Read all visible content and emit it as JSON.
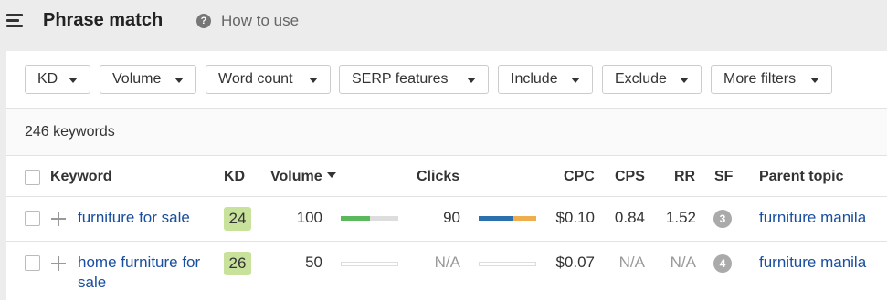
{
  "header": {
    "title": "Phrase match",
    "help_icon_glyph": "?",
    "how_to_use": "How to use"
  },
  "filters": [
    "KD",
    "Volume",
    "Word count",
    "SERP features",
    "Include",
    "Exclude",
    "More filters"
  ],
  "keyword_count": "246 keywords",
  "columns": {
    "keyword": "Keyword",
    "kd": "KD",
    "volume": "Volume",
    "clicks": "Clicks",
    "cpc": "CPC",
    "cps": "CPS",
    "rr": "RR",
    "sf": "SF",
    "parent_topic": "Parent topic"
  },
  "rows": [
    {
      "keyword": "furniture for sale",
      "kd": "24",
      "volume": "100",
      "volume_level": 0.5,
      "clicks": "90",
      "clicks_split": [
        0.6,
        0.4
      ],
      "cpc": "$0.10",
      "cps": "0.84",
      "rr": "1.52",
      "sf": "3",
      "parent_topic": "furniture manila"
    },
    {
      "keyword_line1": "home furniture for",
      "keyword_line2": "sale",
      "kd": "26",
      "volume": "50",
      "volume_level": 0,
      "clicks": "N/A",
      "cpc": "$0.07",
      "cps": "N/A",
      "rr": "N/A",
      "sf": "4",
      "parent_topic": "furniture manila"
    }
  ],
  "colors": {
    "link": "#1a4fa0",
    "kd_badge": "#c9e29b",
    "volume_bar": "#5cb85c",
    "clicks_organic": "#2c6fad",
    "clicks_paid": "#f0ad4e"
  }
}
